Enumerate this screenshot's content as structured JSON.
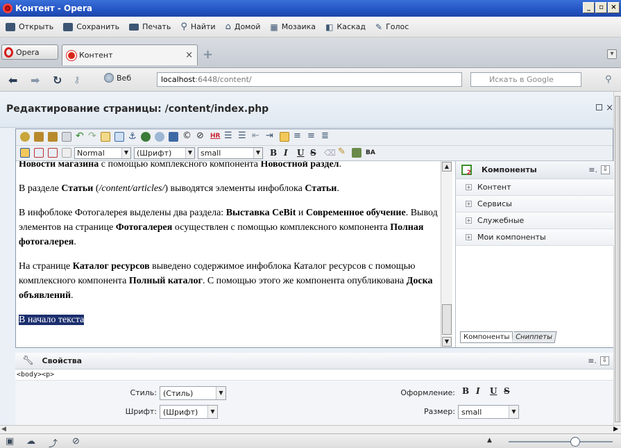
{
  "window": {
    "title": "Контент - Opera",
    "controls": [
      "_",
      "▫",
      "×"
    ]
  },
  "menubar": {
    "items": [
      {
        "label": "Открыть",
        "icon": "folder-icon"
      },
      {
        "label": "Сохранить",
        "icon": "save-icon"
      },
      {
        "label": "Печать",
        "icon": "print-icon"
      },
      {
        "label": "Найти",
        "icon": "find-icon"
      },
      {
        "label": "Домой",
        "icon": "home-icon"
      },
      {
        "label": "Мозаика",
        "icon": "tile-icon"
      },
      {
        "label": "Каскад",
        "icon": "cascade-icon"
      },
      {
        "label": "Голос",
        "icon": "voice-icon"
      }
    ]
  },
  "tabs": {
    "menu_label": "Opera",
    "active_tab": "Контент",
    "close": "×",
    "new_tab": "+"
  },
  "address": {
    "web_label": "Веб",
    "url_host": "localhost",
    "url_rest": ":6448/content/",
    "search_placeholder": "Искать в Google"
  },
  "page": {
    "title": "Редактирование страницы: /content/index.php",
    "close": "×"
  },
  "editor": {
    "style_select": "Normal",
    "font_select": "(Шрифт)",
    "size_select": "small",
    "format": {
      "bold": "B",
      "italic": "I",
      "underline": "U",
      "strike": "S"
    },
    "paragraphs": {
      "p0": {
        "a": "Новости магазина",
        "b": " с помощью комплексного компонента ",
        "c": "Новостной раздел",
        "d": "."
      },
      "p1": {
        "a": "В разделе ",
        "b": "Статьи",
        "c": " (",
        "d": "/content/articles/",
        "e": ") выводятся элементы инфоблока ",
        "f": "Статьи",
        "g": "."
      },
      "p2": {
        "a": "В инфоблоке Фотогалерея выделены два раздела: ",
        "b": "Выставка CeBit",
        "c": " и ",
        "d": "Современное обучение",
        "e": ". Вывод элементов на странице ",
        "f": "Фотогалерея",
        "g": " осуществлен с помощью комплексного компонента ",
        "h": "Полная фотогалерея",
        "i": "."
      },
      "p3": {
        "a": "На странице ",
        "b": "Каталог ресурсов",
        "c": " выведено содержимое инфоблока Каталог ресурсов с помощью комплексного компонента ",
        "d": "Полный каталог",
        "e": ". С помощью этого же компонента опубликована ",
        "f": "Доска объявлений",
        "g": "."
      },
      "p4": {
        "a": "В начало текста"
      }
    }
  },
  "components": {
    "title": "Компоненты",
    "items": [
      "Контент",
      "Сервисы",
      "Служебные",
      "Мои компоненты"
    ],
    "tabs": [
      "Компоненты",
      "Сниппеты"
    ]
  },
  "properties": {
    "title": "Свойства",
    "path": "<body><p>",
    "style_label": "Стиль:",
    "style_value": "(Стиль)",
    "font_label": "Шрифт:",
    "font_value": "(Шрифт)",
    "format_label": "Оформление:",
    "size_label": "Размер:",
    "size_value": "small",
    "format": {
      "bold": "B",
      "italic": "I",
      "underline": "U",
      "strike": "S"
    }
  }
}
